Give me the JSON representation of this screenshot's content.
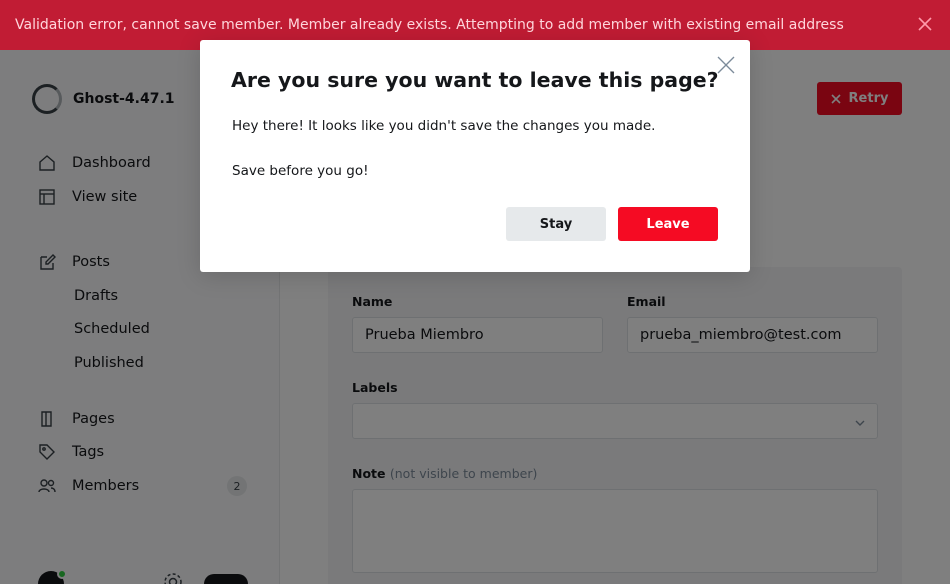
{
  "alert": {
    "message": "Validation error, cannot save member. Member already exists. Attempting to add member with existing email address",
    "color": "#c11c34"
  },
  "sidebar": {
    "site_name": "Ghost-4.47.1",
    "items": [
      {
        "label": "Dashboard",
        "icon": "home-icon"
      },
      {
        "label": "View site",
        "icon": "layout-icon"
      },
      {
        "label": "Posts",
        "icon": "pencil-icon"
      },
      {
        "label": "Drafts"
      },
      {
        "label": "Scheduled"
      },
      {
        "label": "Published"
      },
      {
        "label": "Pages",
        "icon": "pages-icon"
      },
      {
        "label": "Tags",
        "icon": "tag-icon"
      },
      {
        "label": "Members",
        "icon": "members-icon",
        "count": "2"
      }
    ]
  },
  "header": {
    "retry_label": "Retry"
  },
  "form": {
    "name_label": "Name",
    "name_value": "Prueba Miembro",
    "email_label": "Email",
    "email_value": "prueba_miembro@test.com",
    "labels_label": "Labels",
    "note_label": "Note",
    "note_hint": "(not visible to member)"
  },
  "modal": {
    "title": "Are you sure you want to leave this page?",
    "paragraph1": "Hey there! It looks like you didn't save the changes you made.",
    "paragraph2": "Save before you go!",
    "stay_label": "Stay",
    "leave_label": "Leave",
    "accent_color": "#f50b23"
  }
}
